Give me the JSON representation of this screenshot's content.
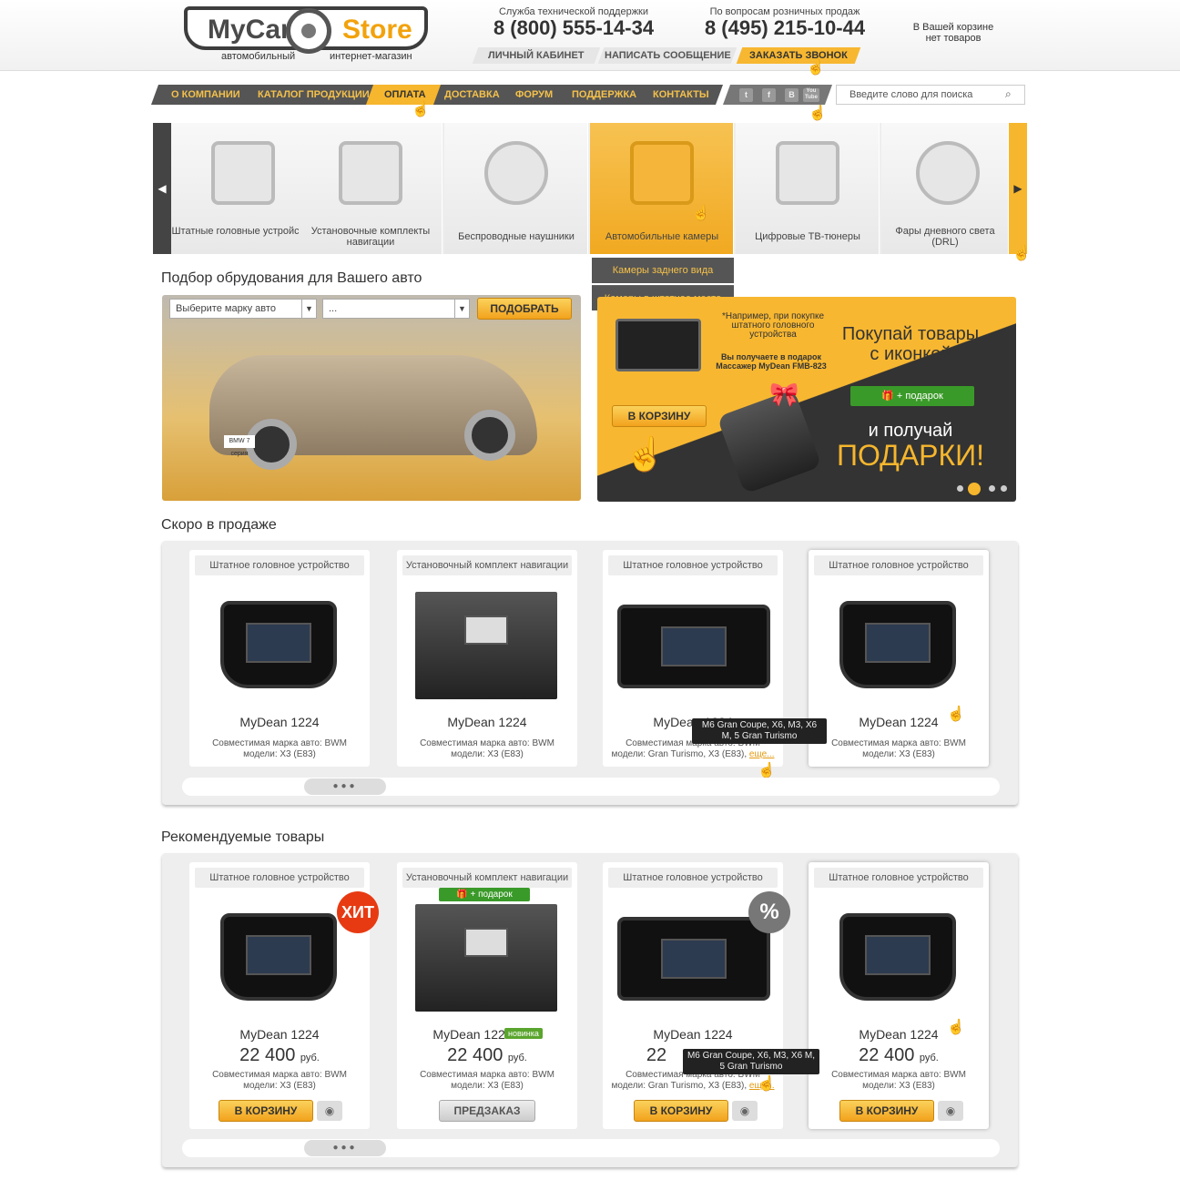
{
  "header": {
    "logo_left": "MyCar",
    "logo_right": "Store",
    "slogan_left": "автомобильный",
    "slogan_right": "интернет-магазин",
    "support_label": "Служба технической поддержки",
    "support_phone": "8 (800) 555-14-34",
    "retail_label": "По вопросам розничных продаж",
    "retail_phone": "8 (495) 215-10-44",
    "cart_line1": "В Вашей корзине",
    "cart_line2": "нет товаров",
    "account": "ЛИЧНЫЙ КАБИНЕТ",
    "message": "НАПИСАТЬ СООБЩЕНИЕ",
    "callback": "ЗАКАЗАТЬ ЗВОНОК"
  },
  "nav": {
    "items": [
      "О КОМПАНИИ",
      "КАТАЛОГ ПРОДУКЦИИ",
      "ОПЛАТА",
      "ДОСТАВКА",
      "ФОРУМ",
      "ПОДДЕРЖКА",
      "КОНТАКТЫ"
    ],
    "social": [
      "t",
      "f",
      "В",
      "You Tube"
    ],
    "search_placeholder": "Введите слово для поиска"
  },
  "categories": [
    {
      "label": "Штатные головные устройства"
    },
    {
      "label": "Установочные комплекты навигации"
    },
    {
      "label": "Беспроводные наушники"
    },
    {
      "label": "Автомобильные камеры"
    },
    {
      "label": "Цифровые ТВ-тюнеры"
    },
    {
      "label": "Фары дневного света (DRL)"
    }
  ],
  "submenu": [
    "Камеры заднего вида",
    "Камеры в штатное место"
  ],
  "picker": {
    "title": "Подбор обрудования для Вашего авто",
    "brand_placeholder": "Выберите марку авто",
    "model_placeholder": "...",
    "button": "ПОДОБРАТЬ",
    "car_plate": "BMW 7 серия"
  },
  "promo": {
    "note": "*Например, при покупке штатного головного устройства",
    "gift_text": "Вы получаете в подарок Массажер MyDean FMB-823",
    "headline1": "Покупай товары",
    "headline2": "с иконкой",
    "gift_btn": "+ подарок",
    "line3": "и получай",
    "line4": "ПОДАРКИ!",
    "cart_btn": "В КОРЗИНУ"
  },
  "soon": {
    "title": "Скоро в продаже",
    "cards": [
      {
        "cat": "Штатное головное устройство",
        "name": "MyDean 1224",
        "desc1": "Совместимая марка авто: BWM",
        "desc2": "модели: X3 (E83)"
      },
      {
        "cat": "Установочный комплект навигации",
        "name": "MyDean 1224",
        "desc1": "Совместимая марка авто: BWM",
        "desc2": "модели: X3 (E83)"
      },
      {
        "cat": "Штатное головное устройство",
        "name": "MyDean 1224",
        "desc1": "Совместимая марка авто: BWM",
        "desc2": "модели: Gran Turismo, X3 (E83),",
        "more": "еще..."
      },
      {
        "cat": "Штатное головное устройство",
        "name": "MyDean 1224",
        "desc1": "Совместимая марка авто: BWM",
        "desc2": "модели: X3 (E83)"
      }
    ],
    "tooltip": "M6 Gran Coupe, X6, M3, X6 M, 5 Gran Turismo"
  },
  "recommended": {
    "title": "Рекомендуемые товары",
    "currency": "руб.",
    "cards": [
      {
        "cat": "Штатное головное устройство",
        "name": "MyDean 1224",
        "price": "22 400",
        "desc1": "Совместимая марка авто: BWM",
        "desc2": "модели: X3 (E83)",
        "btn": "В КОРЗИНУ",
        "badge": "ХИТ"
      },
      {
        "cat": "Установочный комплект навигации",
        "name": "MyDean 1224",
        "price": "22 400",
        "desc1": "Совместимая марка авто: BWM",
        "desc2": "модели: X3 (E83)",
        "btn": "ПРЕДЗАКАЗ",
        "gift": "+ подарок",
        "new": "новинка"
      },
      {
        "cat": "Штатное головное устройство",
        "name": "MyDean 1224",
        "price": "22",
        "desc1": "Совместимая марка авто: BWM",
        "desc2": "модели: Gran Turismo, X3 (E83),",
        "more": "еще...",
        "btn": "В КОРЗИНУ",
        "badge": "%"
      },
      {
        "cat": "Штатное головное устройство",
        "name": "MyDean 1224",
        "price": "22 400",
        "desc1": "Совместимая марка авто: BWM",
        "desc2": "модели: X3 (E83)",
        "btn": "В КОРЗИНУ"
      }
    ],
    "tooltip": "M6 Gran Coupe, X6, M3, X6 M, 5 Gran Turismo"
  },
  "colors": {
    "accent": "#f6b62d",
    "dark": "#555555"
  }
}
